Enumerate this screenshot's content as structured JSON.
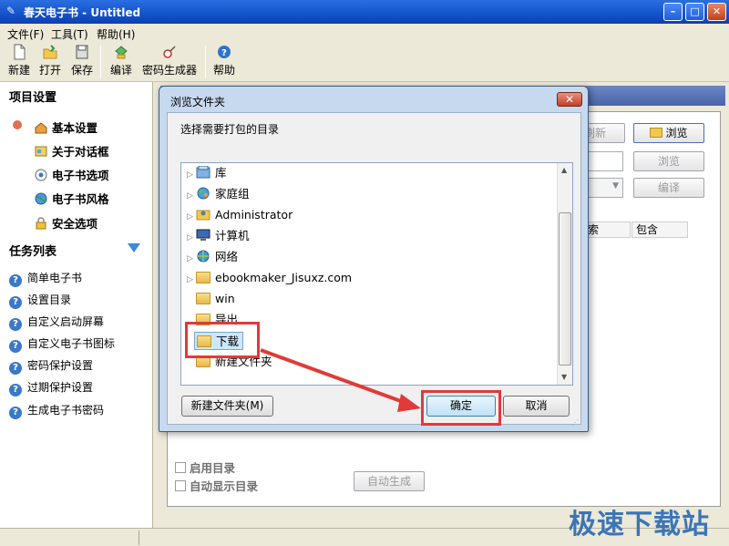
{
  "window": {
    "title": "春天电子书 - Untitled",
    "min_glyph": "–",
    "max_glyph": "□",
    "close_glyph": "✕"
  },
  "menu": {
    "items": [
      "文件(F)",
      "工具(T)",
      "帮助(H)"
    ]
  },
  "toolbar": {
    "buttons": [
      {
        "label": "新建",
        "icon": "new-file-icon"
      },
      {
        "label": "打开",
        "icon": "open-folder-icon"
      },
      {
        "label": "保存",
        "icon": "save-icon"
      },
      {
        "label": "编译",
        "icon": "compile-icon"
      },
      {
        "label": "密码生成器",
        "icon": "password-generator-icon"
      },
      {
        "label": "帮助",
        "icon": "help-icon"
      }
    ]
  },
  "sidebar": {
    "project_heading": "项目设置",
    "project_items": [
      {
        "label": "基本设置",
        "icon": "home-icon"
      },
      {
        "label": "关于对话框",
        "icon": "dialog-icon"
      },
      {
        "label": "电子书选项",
        "icon": "options-icon"
      },
      {
        "label": "电子书风格",
        "icon": "globe-icon"
      },
      {
        "label": "安全选项",
        "icon": "lock-icon"
      }
    ],
    "task_heading": "任务列表",
    "task_items": [
      "简单电子书",
      "设置目录",
      "自定义启动屏幕",
      "自定义电子书图标",
      "密码保护设置",
      "过期保护设置",
      "生成电子书密码"
    ]
  },
  "main": {
    "refresh_label": "刷新",
    "browse_label": "浏览",
    "browse2_label": "浏览",
    "compile_label": "编译",
    "col_search": "索",
    "col_contains": "包含",
    "enable_toc": "启用目录",
    "auto_show_toc": "自动显示目录",
    "auto_generate": "自动生成"
  },
  "dialog": {
    "title": "浏览文件夹",
    "prompt": "选择需要打包的目录",
    "tree": [
      {
        "label": "库",
        "expandable": true,
        "icon": "library-icon"
      },
      {
        "label": "家庭组",
        "expandable": true,
        "icon": "homegroup-icon"
      },
      {
        "label": "Administrator",
        "expandable": true,
        "icon": "user-folder-icon"
      },
      {
        "label": "计算机",
        "expandable": true,
        "icon": "computer-icon"
      },
      {
        "label": "网络",
        "expandable": true,
        "icon": "network-icon"
      },
      {
        "label": "ebookmaker_Jisuxz.com",
        "expandable": true,
        "icon": "folder-icon"
      },
      {
        "label": "win",
        "expandable": false,
        "icon": "folder-icon"
      },
      {
        "label": "导出",
        "expandable": false,
        "icon": "folder-icon"
      },
      {
        "label": "下载",
        "expandable": false,
        "icon": "folder-icon",
        "selected": true
      },
      {
        "label": "新建文件夹",
        "expandable": false,
        "icon": "folder-icon"
      }
    ],
    "new_folder_label": "新建文件夹(M)",
    "ok_label": "确定",
    "cancel_label": "取消"
  },
  "watermark": "极速下载站",
  "colors": {
    "highlight": "#e03a3a",
    "titlebar": "#1552c9",
    "selection": "#cce8ff"
  }
}
